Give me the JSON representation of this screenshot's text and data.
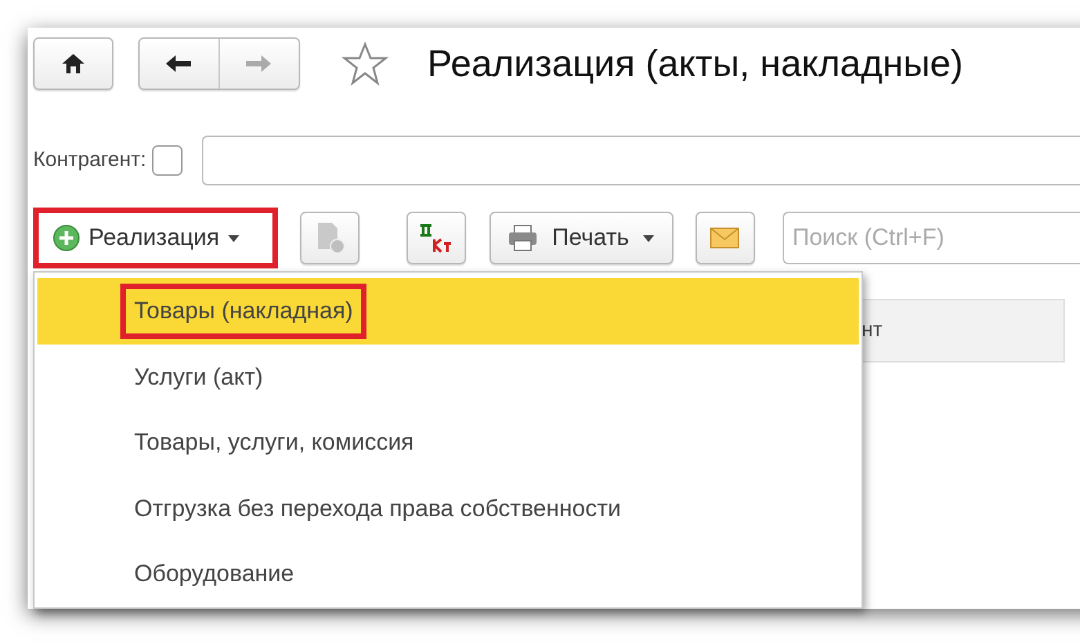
{
  "window": {
    "title": "Реализация (акты, накладные)",
    "favorite": false
  },
  "filter": {
    "label": "Контрагент:",
    "checked": false
  },
  "toolbar": {
    "create_button": {
      "label": "Реализация",
      "annotated": true
    },
    "print_button": {
      "label": "Печать"
    },
    "search": {
      "placeholder": "Поиск (Ctrl+F)"
    }
  },
  "table": {
    "columns": [
      "нт"
    ]
  },
  "dropdown": {
    "items": [
      {
        "label": "Товары (накладная)",
        "selected": true,
        "annotated": true
      },
      {
        "label": "Услуги (акт)",
        "selected": false,
        "annotated": false
      },
      {
        "label": "Товары, услуги, комиссия",
        "selected": false,
        "annotated": false
      },
      {
        "label": "Отгрузка без перехода права собственности",
        "selected": false,
        "annotated": false
      },
      {
        "label": "Оборудование",
        "selected": false,
        "annotated": false
      }
    ]
  }
}
